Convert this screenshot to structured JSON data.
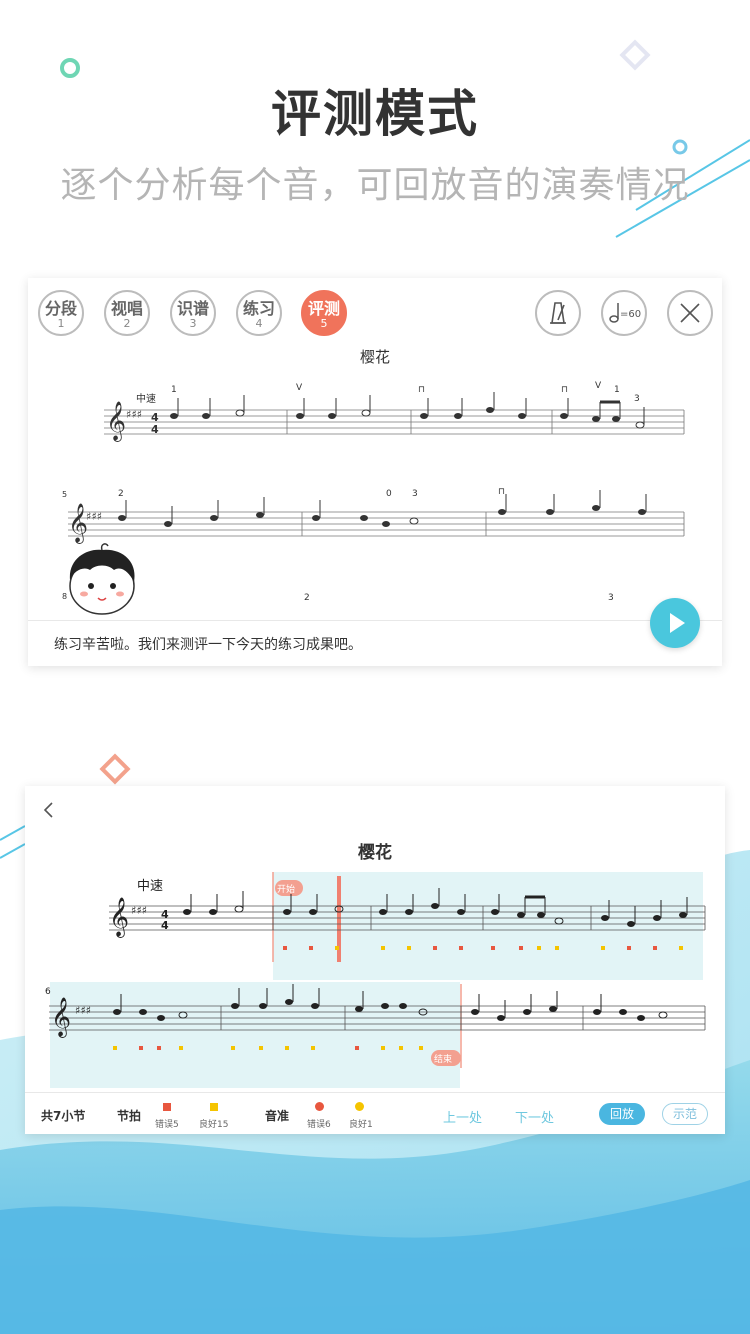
{
  "hero": {
    "title": "评测模式",
    "subtitle": "逐个分析每个音，可回放音的演奏情况"
  },
  "card1": {
    "modes": [
      {
        "label": "分段",
        "num": "1",
        "active": false
      },
      {
        "label": "视唱",
        "num": "2",
        "active": false
      },
      {
        "label": "识谱",
        "num": "3",
        "active": false
      },
      {
        "label": "练习",
        "num": "4",
        "active": false
      },
      {
        "label": "评测",
        "num": "5",
        "active": true
      }
    ],
    "tempo_button": "=60",
    "score_title": "樱花",
    "tempo_marking": "中速",
    "line2_number": "5",
    "line3_number": "8",
    "message": "练习辛苦啦。我们来测评一下今天的练习成果吧。"
  },
  "card2": {
    "score_title": "樱花",
    "tempo_marking": "中速",
    "start_label": "开始",
    "end_label": "结束",
    "line2_number": "6",
    "footer": {
      "total": "共7小节",
      "rhythm_label": "节拍",
      "rhythm_error": "错误5",
      "rhythm_good": "良好15",
      "pitch_label": "音准",
      "pitch_error": "错误6",
      "pitch_good": "良好1",
      "prev": "上一处",
      "next": "下一处",
      "replay": "回放",
      "demo": "示范"
    }
  },
  "colors": {
    "accent_orange": "#f0735b",
    "accent_blue": "#4ac7dd",
    "error_red": "#e8573f",
    "good_yellow": "#f5c400",
    "highlight_bg": "#e2f4f6"
  }
}
